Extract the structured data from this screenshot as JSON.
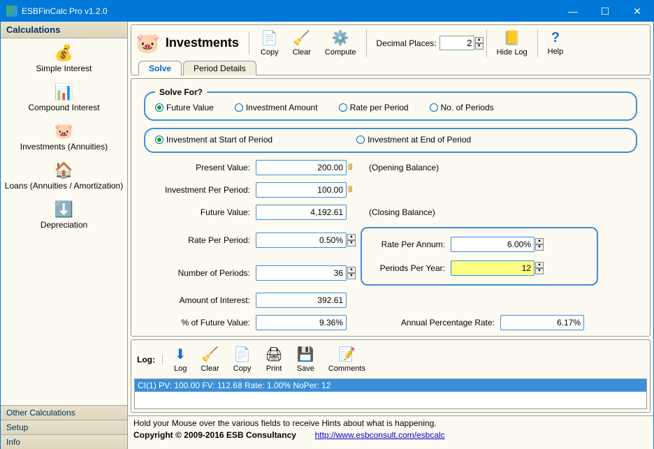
{
  "window": {
    "title": "ESBFinCalc Pro v1.2.0"
  },
  "sidebar": {
    "header": "Calculations",
    "items": [
      {
        "label": "Simple Interest"
      },
      {
        "label": "Compound Interest"
      },
      {
        "label": "Investments (Annuities)"
      },
      {
        "label": "Loans (Annuities / Amortization)"
      },
      {
        "label": "Depreciation"
      }
    ],
    "footer": [
      {
        "label": "Other Calculations"
      },
      {
        "label": "Setup"
      },
      {
        "label": "Info"
      }
    ]
  },
  "section": {
    "title": "Investments",
    "toolbar": {
      "copy": "Copy",
      "clear": "Clear",
      "compute": "Compute",
      "decimal_label": "Decimal Places:",
      "decimal_value": "2",
      "hide_log": "Hide Log",
      "help": "Help"
    },
    "tabs": {
      "solve": "Solve",
      "period": "Period Details"
    }
  },
  "solve": {
    "legend": "Solve For?",
    "opts": [
      "Future Value",
      "Investment Amount",
      "Rate per Period",
      "No. of Periods"
    ],
    "timing": [
      "Investment at Start of Period",
      "Investment at End of Period"
    ]
  },
  "fields": {
    "present_value_label": "Present Value:",
    "present_value": "200.00",
    "opening_note": "(Opening Balance)",
    "invest_per_period_label": "Investment Per Period:",
    "invest_per_period": "100.00",
    "future_value_label": "Future Value:",
    "future_value": "4,192.61",
    "closing_note": "(Closing Balance)",
    "rate_per_period_label": "Rate Per Period:",
    "rate_per_period": "0.50%",
    "num_periods_label": "Number of Periods:",
    "num_periods": "36",
    "amount_interest_label": "Amount of Interest:",
    "amount_interest": "392.61",
    "pct_future_label": "% of Future Value:",
    "pct_future": "9.36%",
    "rate_annum_label": "Rate Per Annum:",
    "rate_annum": "6.00%",
    "periods_year_label": "Periods Per Year:",
    "periods_year": "12",
    "apr_label": "Annual Percentage Rate:",
    "apr": "6.17%"
  },
  "log": {
    "label": "Log:",
    "buttons": {
      "log": "Log",
      "clear": "Clear",
      "copy": "Copy",
      "print": "Print",
      "save": "Save",
      "comments": "Comments"
    },
    "entry": "CI(1) PV: 100.00 FV: 112.68 Rate: 1.00% NoPer: 12"
  },
  "status": {
    "hint": "Hold your Mouse over the various fields to receive Hints about what is happening.",
    "copyright": "Copyright © 2009-2016 ESB Consultancy",
    "url": "http://www.esbconsult.com/esbcalc"
  }
}
